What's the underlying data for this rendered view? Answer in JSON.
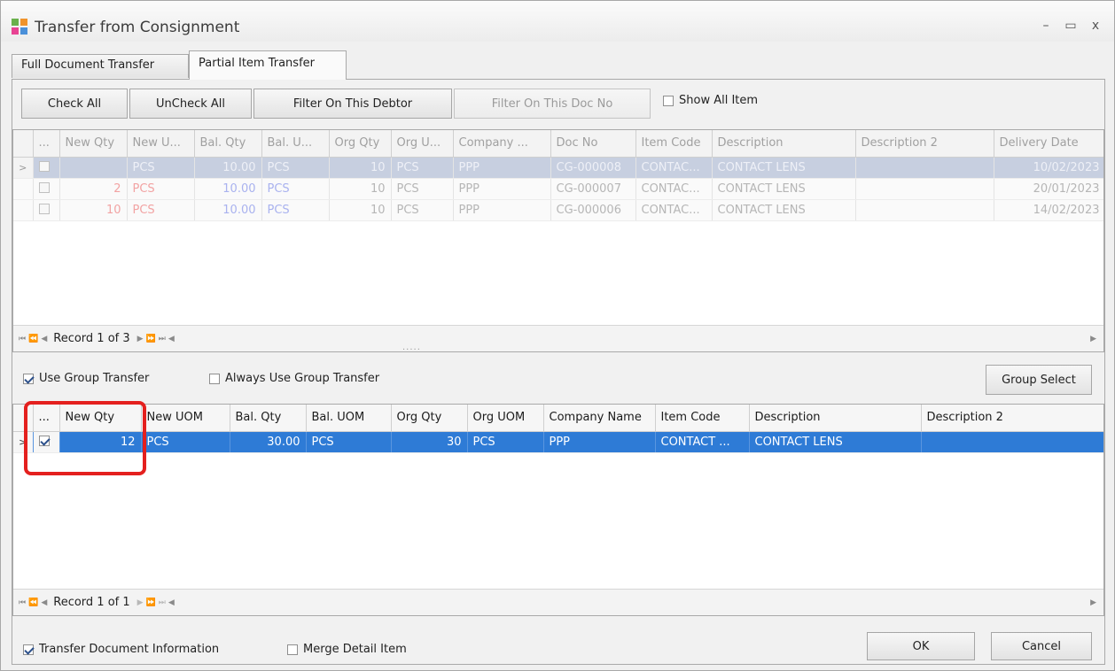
{
  "window": {
    "title": "Transfer from Consignment",
    "controls": {
      "minimize": "–",
      "maximize": "▭",
      "close": "x"
    }
  },
  "tabs": [
    {
      "label": "Full Document Transfer",
      "active": false
    },
    {
      "label": "Partial Item Transfer",
      "active": true
    }
  ],
  "toolbar": {
    "check_all": "Check All",
    "uncheck_all": "UnCheck All",
    "filter_debtor": "Filter On This Debtor",
    "filter_doc": "Filter On This Doc No",
    "show_all_item": "Show All Item"
  },
  "top_grid": {
    "columns": [
      "...",
      "New Qty",
      "New U...",
      "Bal. Qty",
      "Bal. U...",
      "Org Qty",
      "Org U...",
      "Company ...",
      "Doc No",
      "Item Code",
      "Description",
      "Description 2",
      "Delivery Date"
    ],
    "rows": [
      {
        "new_qty": "",
        "new_uom": "PCS",
        "bal_qty": "10.00",
        "bal_uom": "PCS",
        "org_qty": "10",
        "org_uom": "PCS",
        "company": "PPP",
        "doc_no": "CG-000008",
        "item_code": "CONTAC...",
        "description": "CONTACT LENS",
        "description2": "",
        "delivery_date": "10/02/2023",
        "selected": true
      },
      {
        "new_qty": "2",
        "new_uom": "PCS",
        "bal_qty": "10.00",
        "bal_uom": "PCS",
        "org_qty": "10",
        "org_uom": "PCS",
        "company": "PPP",
        "doc_no": "CG-000007",
        "item_code": "CONTAC...",
        "description": "CONTACT LENS",
        "description2": "",
        "delivery_date": "20/01/2023",
        "selected": false
      },
      {
        "new_qty": "10",
        "new_uom": "PCS",
        "bal_qty": "10.00",
        "bal_uom": "PCS",
        "org_qty": "10",
        "org_uom": "PCS",
        "company": "PPP",
        "doc_no": "CG-000006",
        "item_code": "CONTAC...",
        "description": "CONTACT LENS",
        "description2": "",
        "delivery_date": "14/02/2023",
        "selected": false
      }
    ],
    "nav": "Record 1 of 3"
  },
  "group": {
    "use_group_transfer": "Use Group Transfer",
    "use_group_transfer_checked": true,
    "always_use_group_transfer": "Always Use Group Transfer",
    "always_use_group_transfer_checked": false,
    "group_select": "Group Select"
  },
  "bottom_grid": {
    "columns": [
      "...",
      "New Qty",
      "New UOM",
      "Bal. Qty",
      "Bal. UOM",
      "Org Qty",
      "Org UOM",
      "Company Name",
      "Item Code",
      "Description",
      "Description 2"
    ],
    "rows": [
      {
        "new_qty": "12",
        "new_uom": "PCS",
        "bal_qty": "30.00",
        "bal_uom": "PCS",
        "org_qty": "30",
        "org_uom": "PCS",
        "company": "PPP",
        "item_code": "CONTACT ...",
        "description": "CONTACT LENS",
        "description2": "",
        "checked": true
      }
    ],
    "nav": "Record 1 of 1"
  },
  "footer": {
    "transfer_doc_info": "Transfer Document Information",
    "transfer_doc_info_checked": true,
    "merge_detail_item": "Merge Detail Item",
    "merge_detail_item_checked": false,
    "ok": "OK",
    "cancel": "Cancel"
  },
  "colors": {
    "selection_blue": "#2e7bd6",
    "highlight_red": "#e4201e"
  }
}
